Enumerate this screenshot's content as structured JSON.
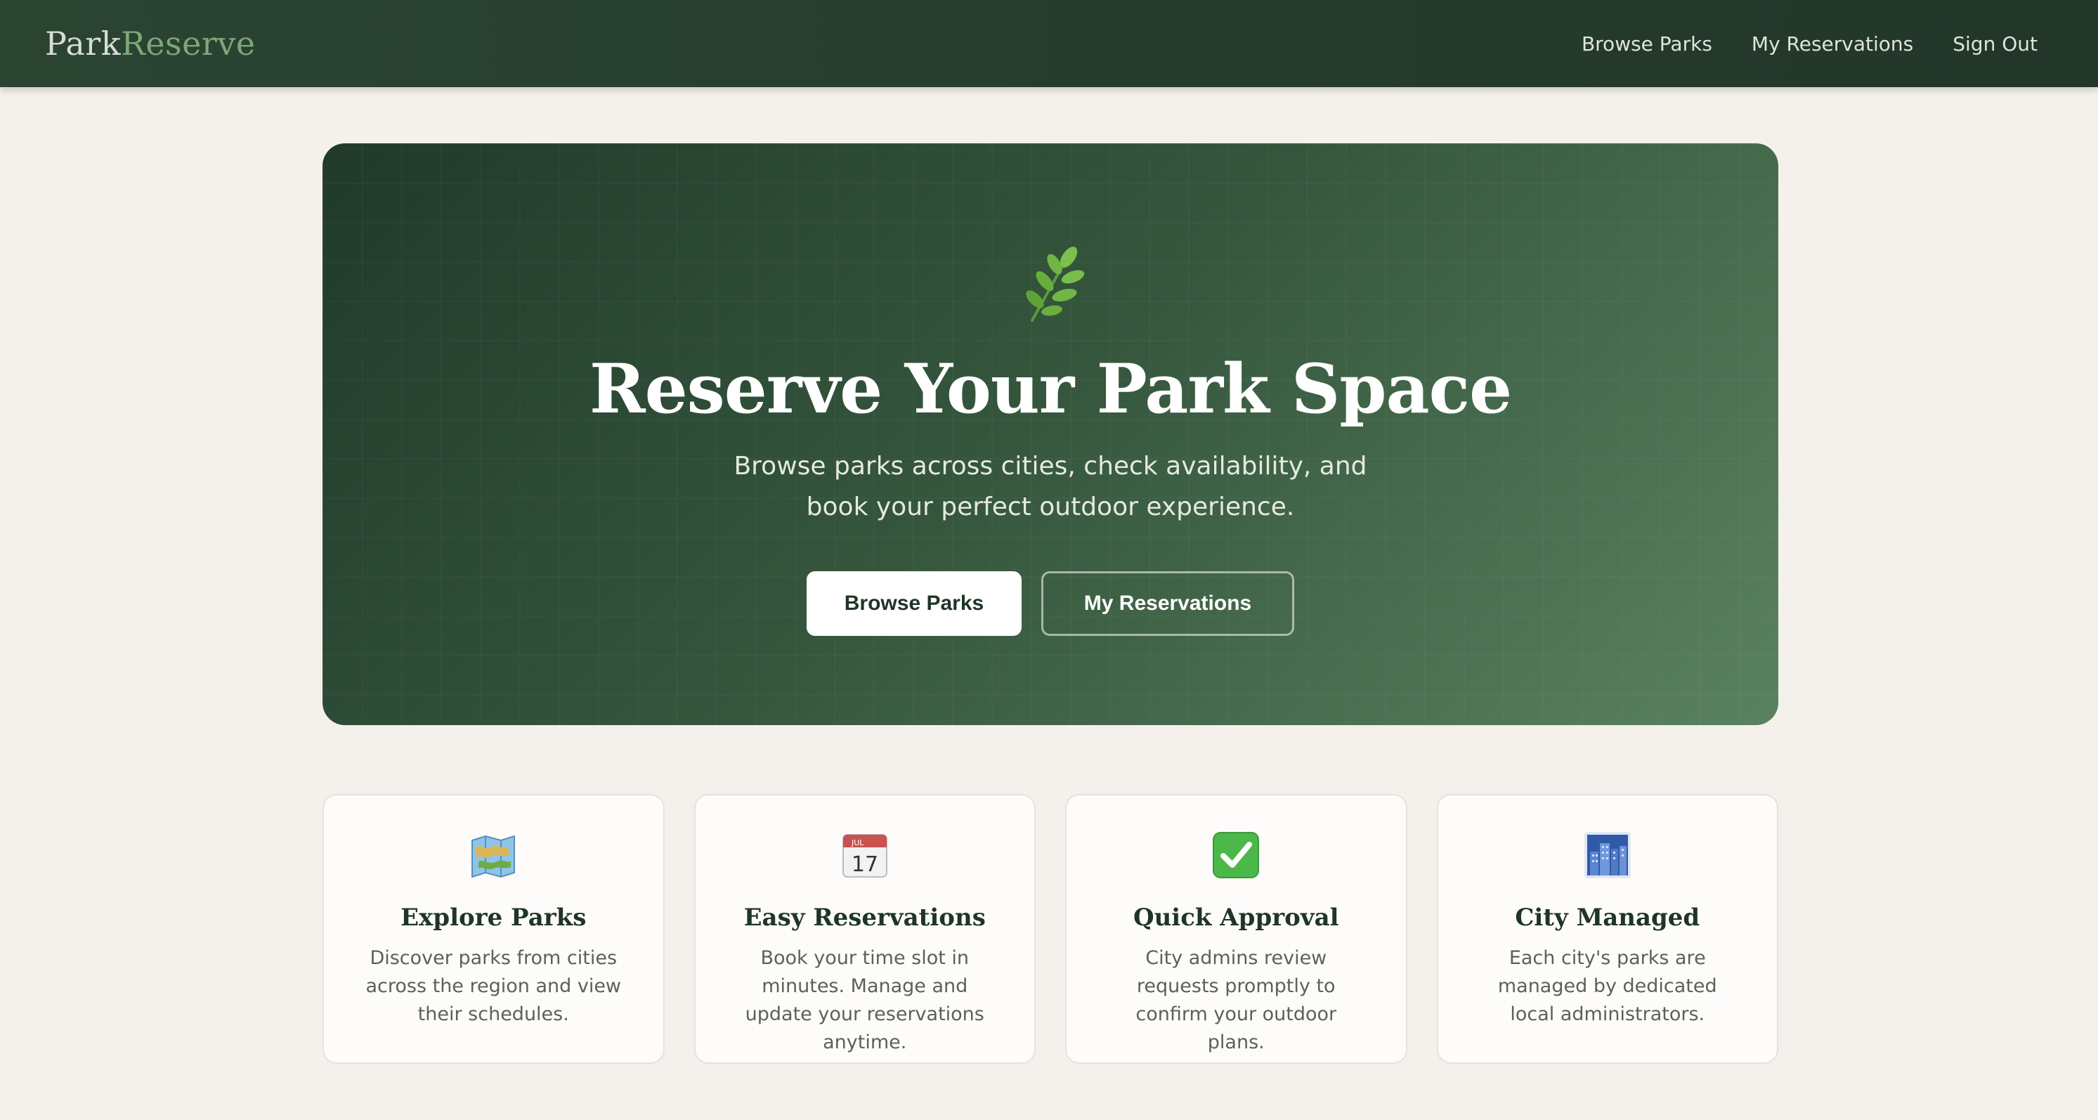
{
  "nav": {
    "logo_part1": "Park",
    "logo_part2": "Reserve",
    "links": [
      "Browse Parks",
      "My Reservations",
      "Sign Out"
    ]
  },
  "hero": {
    "icon": "leaf-branch-icon",
    "title": "Reserve Your Park Space",
    "subtitle": "Browse parks across cities, check availability, and book your perfect outdoor experience.",
    "primary_button": "Browse Parks",
    "secondary_button": "My Reservations"
  },
  "features": [
    {
      "icon": "map-icon",
      "title": "Explore Parks",
      "description": "Discover parks from cities across the region and view their schedules."
    },
    {
      "icon": "calendar-icon",
      "calendar_month": "JUL",
      "calendar_day": "17",
      "title": "Easy Reservations",
      "description": "Book your time slot in minutes. Manage and update your reservations anytime."
    },
    {
      "icon": "check-mark-icon",
      "title": "Quick Approval",
      "description": "City admins review requests promptly to confirm your outdoor plans."
    },
    {
      "icon": "city-buildings-icon",
      "title": "City Managed",
      "description": "Each city's parks are managed by dedicated local administrators."
    }
  ],
  "colors": {
    "nav_bg": "#22362a",
    "accent_green": "#7fa87a",
    "page_bg": "#f4f0eb",
    "hero_dark": "#213a2a",
    "hero_light": "#5a8260"
  }
}
